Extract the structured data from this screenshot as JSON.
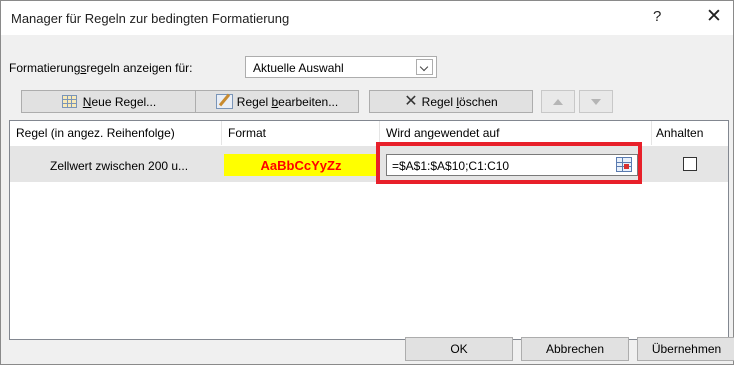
{
  "window": {
    "title": "Manager für Regeln zur bedingten Formatierung",
    "help_label": "?",
    "close_label": "✕"
  },
  "filter": {
    "label_prefix": "Formatierung",
    "label_underlined": "s",
    "label_suffix": "regeln anzeigen für:",
    "selected": "Aktuelle Auswahl"
  },
  "toolbar": {
    "new_rule": {
      "prefix": "",
      "underlined": "N",
      "suffix": "eue Regel..."
    },
    "edit_rule": {
      "prefix": "Regel ",
      "underlined": "b",
      "suffix": "earbeiten..."
    },
    "delete_rule": {
      "prefix": "Regel ",
      "underlined": "l",
      "suffix": "öschen"
    }
  },
  "table": {
    "columns": {
      "rule": "Regel (in angez. Reihenfolge)",
      "format": "Format",
      "applies_to": "Wird angewendet auf",
      "stop": "Anhalten"
    },
    "rows": [
      {
        "rule": "Zellwert zwischen 200 u...",
        "format_preview": "AaBbCcYyZz",
        "applies_to": "=$A$1:$A$10;C1:C10",
        "stop_if_true": false
      }
    ]
  },
  "buttons": {
    "ok": "OK",
    "cancel": "Abbrechen",
    "apply": "Übernehmen"
  },
  "colors": {
    "format_bg": "#ffff00",
    "format_fg": "#ff0000",
    "highlight": "#e8202a"
  }
}
